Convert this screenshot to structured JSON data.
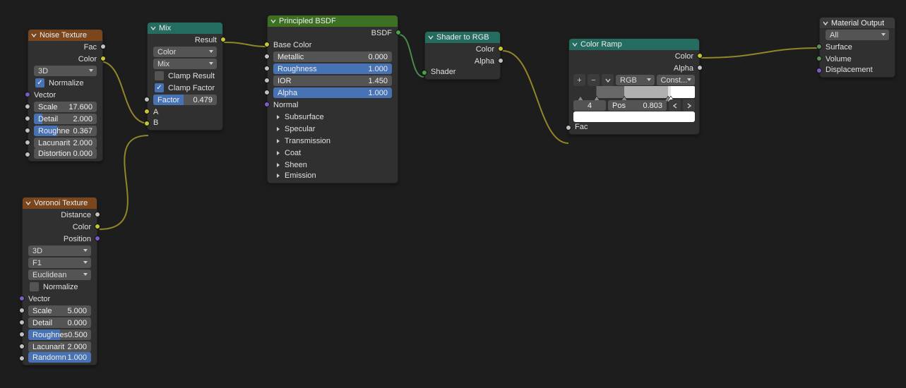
{
  "noise": {
    "title": "Noise Texture",
    "fac": "Fac",
    "color": "Color",
    "dim_dd": "3D",
    "normalize": "Normalize",
    "vector": "Vector",
    "scale_l": "Scale",
    "scale_v": "17.600",
    "detail_l": "Detail",
    "detail_v": "2.000",
    "rough_l": "Roughne",
    "rough_v": "0.367",
    "lac_l": "Lacunarit",
    "lac_v": "2.000",
    "dist_l": "Distortion",
    "dist_v": "0.000"
  },
  "voronoi": {
    "title": "Voronoi Texture",
    "distance": "Distance",
    "color": "Color",
    "position": "Position",
    "dim_dd": "3D",
    "feat_dd": "F1",
    "metric_dd": "Euclidean",
    "normalize": "Normalize",
    "vector": "Vector",
    "scale_l": "Scale",
    "scale_v": "5.000",
    "detail_l": "Detail",
    "detail_v": "0.000",
    "rough_l": "Roughnes",
    "rough_v": "0.500",
    "lac_l": "Lacunarit",
    "lac_v": "2.000",
    "rand_l": "Randomn",
    "rand_v": "1.000"
  },
  "mix": {
    "title": "Mix",
    "result": "Result",
    "type_dd": "Color",
    "blend_dd": "Mix",
    "clamp_result": "Clamp Result",
    "clamp_factor": "Clamp Factor",
    "factor_l": "Factor",
    "factor_v": "0.479",
    "a": "A",
    "b": "B"
  },
  "bsdf": {
    "title": "Principled BSDF",
    "bsdf_out": "BSDF",
    "base_color": "Base Color",
    "metallic_l": "Metallic",
    "metallic_v": "0.000",
    "rough_l": "Roughness",
    "rough_v": "1.000",
    "ior_l": "IOR",
    "ior_v": "1.450",
    "alpha_l": "Alpha",
    "alpha_v": "1.000",
    "normal": "Normal",
    "subsurface": "Subsurface",
    "specular": "Specular",
    "transmission": "Transmission",
    "coat": "Coat",
    "sheen": "Sheen",
    "emission": "Emission"
  },
  "shadertorgb": {
    "title": "Shader to RGB",
    "color": "Color",
    "alpha": "Alpha",
    "shader": "Shader"
  },
  "ramp": {
    "title": "Color Ramp",
    "color": "Color",
    "alpha": "Alpha",
    "mode_dd": "RGB",
    "interp_dd": "Const...",
    "idx": "4",
    "pos_l": "Pos",
    "pos_v": "0.803",
    "fac": "Fac",
    "stops": [
      {
        "pos": 0.06,
        "color": "#303030"
      },
      {
        "pos": 0.19,
        "color": "#686868"
      },
      {
        "pos": 0.42,
        "color": "#b0b0b0"
      },
      {
        "pos": 0.78,
        "color": "#e2e2e2"
      },
      {
        "pos": 0.803,
        "color": "#ffffff"
      }
    ],
    "swatch_color": "#ffffff"
  },
  "output": {
    "title": "Material Output",
    "target_dd": "All",
    "surface": "Surface",
    "volume": "Volume",
    "displacement": "Displacement"
  },
  "chart_data": {
    "type": "node_graph",
    "app": "Blender Shader Editor",
    "nodes": [
      "Noise Texture",
      "Voronoi Texture",
      "Mix",
      "Principled BSDF",
      "Shader to RGB",
      "Color Ramp",
      "Material Output"
    ],
    "edges": [
      [
        "Noise Texture.Color",
        "Mix.A"
      ],
      [
        "Voronoi Texture.Color",
        "Mix.B"
      ],
      [
        "Mix.Result",
        "Principled BSDF.Base Color"
      ],
      [
        "Principled BSDF.BSDF",
        "Shader to RGB.Shader"
      ],
      [
        "Shader to RGB.Color",
        "Color Ramp.Fac"
      ],
      [
        "Color Ramp.Color",
        "Material Output.Surface"
      ]
    ]
  }
}
